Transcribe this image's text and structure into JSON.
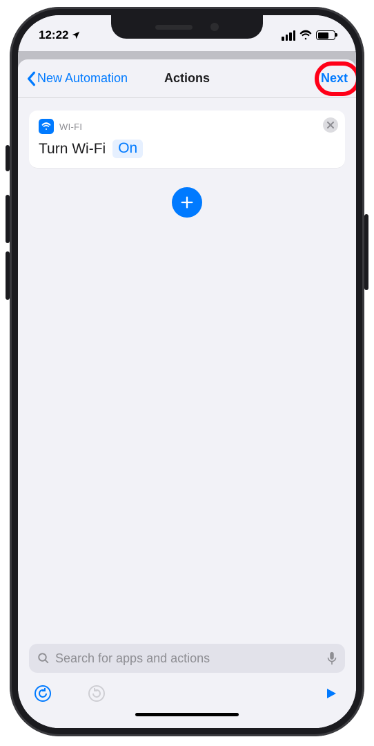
{
  "status": {
    "time": "12:22"
  },
  "nav": {
    "back_label": "New Automation",
    "title": "Actions",
    "next_label": "Next"
  },
  "action_card": {
    "category": "WI-FI",
    "prefix": "Turn Wi-Fi",
    "state": "On"
  },
  "search": {
    "placeholder": "Search for apps and actions"
  }
}
